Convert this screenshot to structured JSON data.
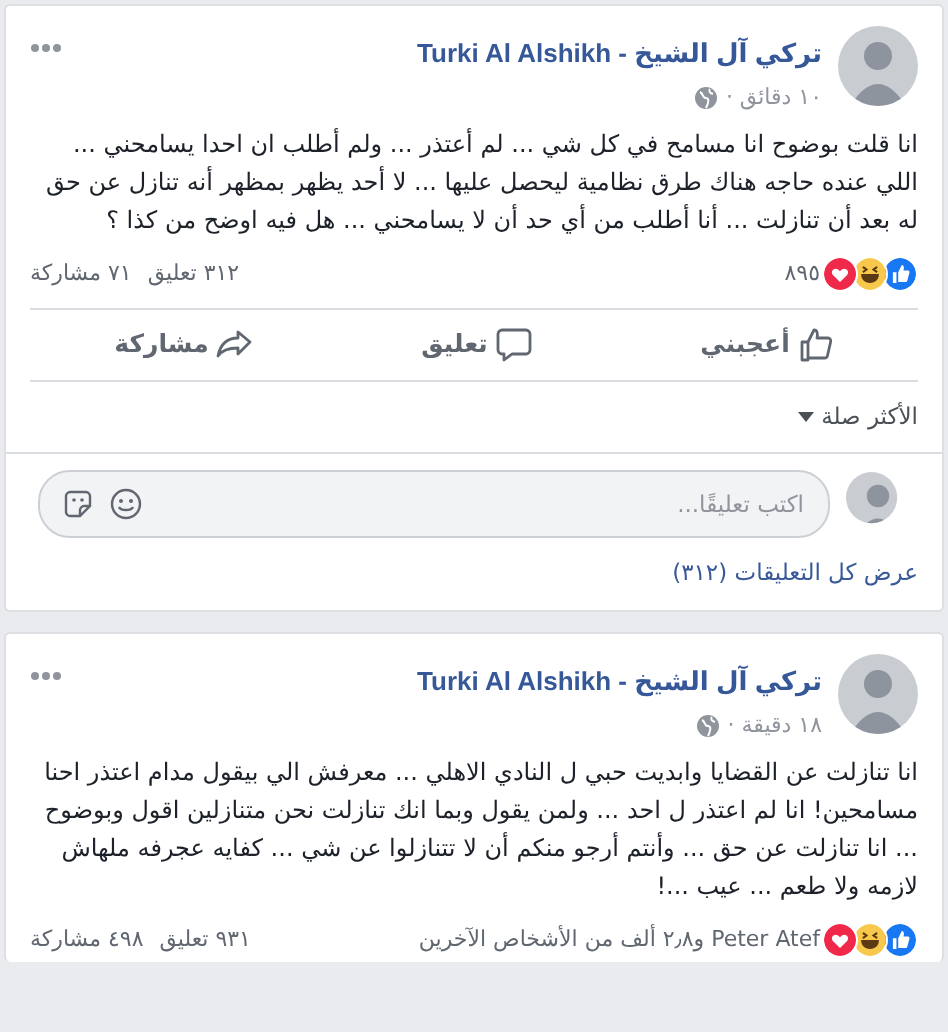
{
  "posts": [
    {
      "author": "تركي آل الشيخ - Turki Al Alshikh",
      "time": "١٠ دقائق ·",
      "text": "انا قلت بوضوح انا مسامح في كل شي ... لم أعتذر ... ولم أطلب ان احدا يسامحني ... اللي عنده حاجه هناك طرق نظامية ليحصل عليها ... لا أحد يظهر بمظهر أنه تنازل عن حق له بعد أن تنازلت ... أنا أطلب من أي حد أن لا يسامحني ... هل فيه اوضح من كذا ؟",
      "reactions": [
        {
          "kind": "like"
        },
        {
          "kind": "haha"
        },
        {
          "kind": "love"
        }
      ],
      "reaction_summary": "٨٩٥",
      "comments": "٣١٢ تعليق",
      "shares": "٧١ مشاركة",
      "actions": [
        {
          "kind": "like",
          "label": "أعجبني"
        },
        {
          "kind": "comment",
          "label": "تعليق"
        },
        {
          "kind": "share",
          "label": "مشاركة"
        }
      ],
      "sort": "الأكثر صلة",
      "comment_box": {
        "placeholder": "اكتب تعليقًا..."
      },
      "view_all": "عرض كل التعليقات (٣١٢)"
    },
    {
      "author": "تركي آل الشيخ - Turki Al Alshikh",
      "time": "١٨ دقيقة ·",
      "text": "انا تنازلت عن القضايا وابديت حبي ل النادي الاهلي ... معرفش الي بيقول مدام اعتذر احنا مسامحين! انا لم اعتذر ل احد ... ولمن يقول وبما انك تنازلت نحن متنازلين اقول وبوضوح ... انا تنازلت عن حق ... وأنتم أرجو منكم أن لا تتنازلوا عن شي ... كفايه عجرفه ملهاش لازمه ولا طعم ... عيب ...!",
      "reactions": [
        {
          "kind": "like"
        },
        {
          "kind": "haha"
        },
        {
          "kind": "love"
        }
      ],
      "reaction_summary": "Peter Atef و٢٫٨ ألف من الأشخاص الآخرين",
      "comments": "٩٣١ تعليق",
      "shares": "٤٩٨ مشاركة"
    }
  ]
}
